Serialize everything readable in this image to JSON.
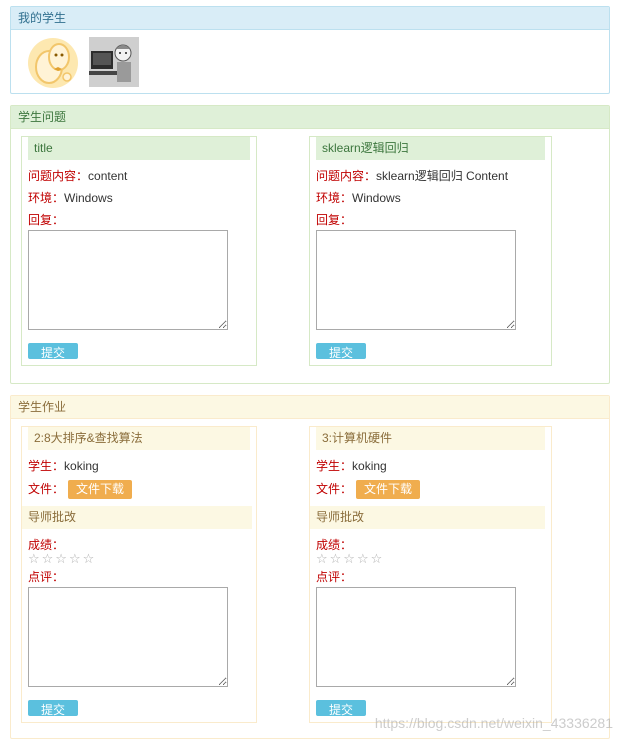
{
  "students_panel": {
    "title": "我的学生"
  },
  "questions_panel": {
    "title": "学生问题",
    "cards": [
      {
        "title": "title",
        "content_label": "问题内容：",
        "content_value": "content",
        "env_label": "环境：",
        "env_value": "Windows",
        "reply_label": "回复：",
        "submit_label": "提交"
      },
      {
        "title": "sklearn逻辑回归",
        "content_label": "问题内容：",
        "content_value": "sklearn逻辑回归 Content",
        "env_label": "环境：",
        "env_value": "Windows",
        "reply_label": "回复：",
        "submit_label": "提交"
      }
    ]
  },
  "homework_panel": {
    "title": "学生作业",
    "cards": [
      {
        "title": "2:8大排序&查找算法",
        "student_label": "学生：",
        "student_value": "koking",
        "file_label": "文件：",
        "download_label": "文件下载",
        "review_title": "导师批改",
        "score_label": "成绩：",
        "stars": "☆☆☆☆☆",
        "comment_label": "点评：",
        "submit_label": "提交"
      },
      {
        "title": "3:计算机硬件",
        "student_label": "学生：",
        "student_value": "koking",
        "file_label": "文件：",
        "download_label": "文件下载",
        "review_title": "导师批改",
        "score_label": "成绩：",
        "stars": "☆☆☆☆☆",
        "comment_label": "点评：",
        "submit_label": "提交"
      }
    ]
  },
  "watermark": "https://blog.csdn.net/weixin_43336281",
  "colors": {
    "blue_head": "#d9edf7",
    "green_head": "#dff0d8",
    "yellow_head": "#fcf8e3",
    "label_red": "#c00000",
    "submit_blue": "#5bc0de",
    "download_orange": "#f0ad4e"
  }
}
